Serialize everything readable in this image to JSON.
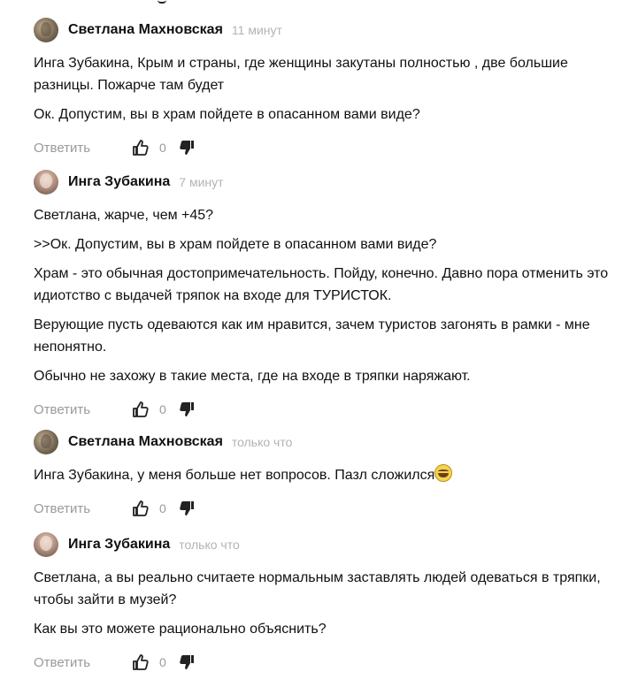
{
  "comments": [
    {
      "author": "Светлана Махновская",
      "time": "11 минут",
      "paragraphs": [
        "Инга Зубакина, Крым и страны, где женщины закутаны полностью , две большие разницы. Пожарче там будет",
        "Ок. Допустим, вы в храм пойдете в опасанном вами виде?"
      ],
      "reply_label": "Ответить",
      "likes": "0"
    },
    {
      "author": "Инга Зубакина",
      "time": "7 минут",
      "paragraphs": [
        "Светлана, жарче, чем +45?",
        ">>Ок. Допустим, вы в храм пойдете в опасанном вами виде?",
        "Храм - это обычная достопримечательность. Пойду, конечно. Давно пора отменить это идиотство с выдачей тряпок на входе для ТУРИСТОК.",
        "Верующие пусть одеваются как им нравится, зачем туристов загонять в рамки - мне непонятно.",
        "Обычно не захожу в такие места, где на входе в тряпки наряжают."
      ],
      "reply_label": "Ответить",
      "likes": "0"
    },
    {
      "author": "Светлана Махновская",
      "time": "только что",
      "paragraphs": [
        "Инга Зубакина, у меня больше нет вопросов. Пазл сложился"
      ],
      "emoji": "grinning-sweat-emoji",
      "reply_label": "Ответить",
      "likes": "0"
    },
    {
      "author": "Инга Зубакина",
      "time": "только что",
      "paragraphs": [
        "Светлана, а вы реально считаете нормальным заставлять людей одеваться в тряпки, чтобы зайти в музей?",
        "Как вы это можете рационально объяснить?"
      ],
      "reply_label": "Ответить",
      "likes": "0"
    }
  ],
  "icons": {
    "like": "thumbs-up-icon",
    "dislike": "thumbs-down-icon"
  },
  "colors": {
    "text": "#111111",
    "muted": "#9a9a9a",
    "time": "#b3b3b3"
  }
}
